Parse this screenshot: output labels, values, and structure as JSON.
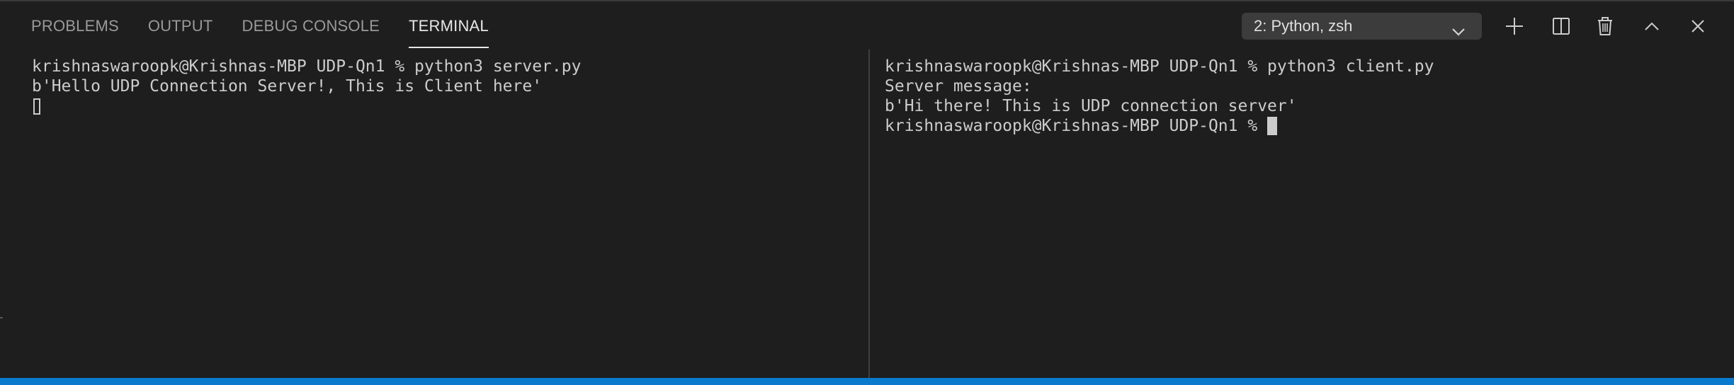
{
  "tabs": [
    {
      "label": "PROBLEMS",
      "active": false
    },
    {
      "label": "OUTPUT",
      "active": false
    },
    {
      "label": "DEBUG CONSOLE",
      "active": false
    },
    {
      "label": "TERMINAL",
      "active": true
    }
  ],
  "terminal_selector": {
    "selected": "2: Python, zsh",
    "icon": "chevron-down-icon"
  },
  "actions": [
    {
      "name": "new-terminal",
      "icon": "plus-icon"
    },
    {
      "name": "split-terminal",
      "icon": "split-icon"
    },
    {
      "name": "kill-terminal",
      "icon": "trash-icon"
    },
    {
      "name": "maximize-panel",
      "icon": "chevron-up-icon"
    },
    {
      "name": "close-panel",
      "icon": "close-icon"
    }
  ],
  "left_pane": {
    "lines": [
      "krishnaswaroopk@Krishnas-MBP UDP-Qn1 % python3 server.py",
      "b'Hello UDP Connection Server!, This is Client here'"
    ]
  },
  "right_pane": {
    "lines": [
      "krishnaswaroopk@Krishnas-MBP UDP-Qn1 % python3 client.py",
      "Server message:",
      "b'Hi there! This is UDP connection server'"
    ],
    "prompt": "krishnaswaroopk@Krishnas-MBP UDP-Qn1 %"
  },
  "colors": {
    "background": "#1e1e1e",
    "text": "#cccccc",
    "status_bar": "#0a7acc"
  }
}
